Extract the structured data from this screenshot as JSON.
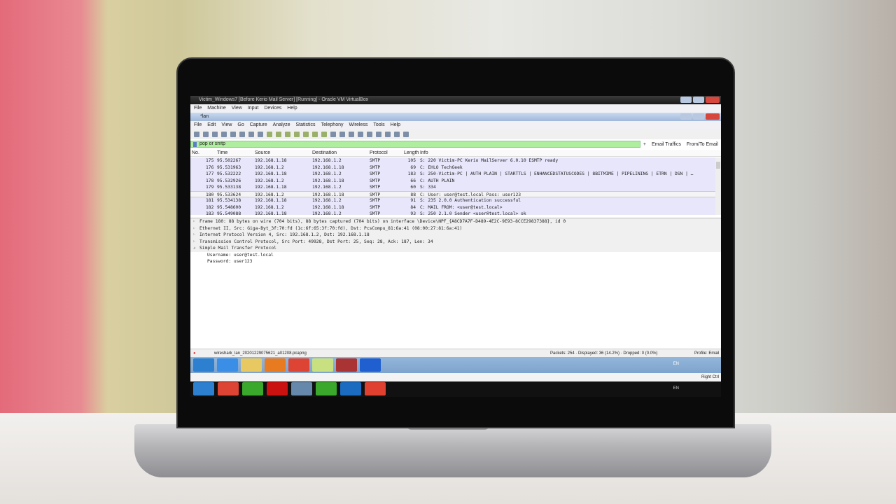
{
  "vbox": {
    "title": "Victim_Windows7 [Before Kerio Mail Server] [Running] - Oracle VM VirtualBox",
    "menu": [
      "File",
      "Machine",
      "View",
      "Input",
      "Devices",
      "Help"
    ],
    "status_right": "Right Ctrl"
  },
  "wireshark": {
    "title": "*lan",
    "menu": [
      "File",
      "Edit",
      "View",
      "Go",
      "Capture",
      "Analyze",
      "Statistics",
      "Telephony",
      "Wireless",
      "Tools",
      "Help"
    ],
    "filter": "pop or smtp",
    "filter_buttons": [
      "+",
      "Email Traffics",
      "From/To Email"
    ],
    "columns": [
      "No.",
      "Time",
      "Source",
      "Destination",
      "Protocol",
      "Length",
      "Info"
    ],
    "packets": [
      [
        "175",
        "95.502267",
        "192.168.1.18",
        "192.168.1.2",
        "SMTP",
        "105",
        "S: 220 Victim-PC Kerio MailServer 6.0.10 ESMTP ready"
      ],
      [
        "176",
        "95.531963",
        "192.168.1.2",
        "192.168.1.18",
        "SMTP",
        "69",
        "C: EHLO TechGeek"
      ],
      [
        "177",
        "95.532222",
        "192.168.1.18",
        "192.168.1.2",
        "SMTP",
        "183",
        "S: 250-Victim-PC | AUTH PLAIN | STARTTLS | ENHANCEDSTATUSCODES | 8BITMIME | PIPELINING | ETRN | DSN | …"
      ],
      [
        "178",
        "95.532926",
        "192.168.1.2",
        "192.168.1.18",
        "SMTP",
        "66",
        "C: AUTH PLAIN"
      ],
      [
        "179",
        "95.533138",
        "192.168.1.18",
        "192.168.1.2",
        "SMTP",
        "60",
        "S: 334"
      ],
      [
        "180",
        "95.533624",
        "192.168.1.2",
        "192.168.1.18",
        "SMTP",
        "88",
        "C: User: user@test.local  Pass: user123"
      ],
      [
        "181",
        "95.534138",
        "192.168.1.18",
        "192.168.1.2",
        "SMTP",
        "91",
        "S: 235 2.0.0 Authentication successful"
      ],
      [
        "182",
        "95.548600",
        "192.168.1.2",
        "192.168.1.18",
        "SMTP",
        "84",
        "C: MAIL FROM: <user@test.local>"
      ],
      [
        "183",
        "95.549088",
        "192.168.1.18",
        "192.168.1.2",
        "SMTP",
        "93",
        "S: 250 2.1.0 Sender <user@test.local> ok"
      ]
    ],
    "selected_packet": "180",
    "details": [
      "Frame 180: 88 bytes on wire (704 bits), 88 bytes captured (704 bits) on interface \\Device\\NPF_{A8CD7A7F-D489-4E2C-9E93-8CCE29837388}, id 0",
      "Ethernet II, Src: Giga-Byt_3f:70:fd (1c:6f:65:3f:70:fd), Dst: PcsCompu_81:6a:41 (08:00:27:81:6a:41)",
      "Internet Protocol Version 4, Src: 192.168.1.2, Dst: 192.168.1.18",
      "Transmission Control Protocol, Src Port: 49928, Dst Port: 25, Seq: 28, Ack: 187, Len: 34",
      "Simple Mail Transfer Protocol"
    ],
    "smtp_fields": [
      "Username: user@test.local",
      "Password: user123"
    ],
    "status_file": "wireshark_lan_20201229075621_a01208.pcapng",
    "status_counts": "Packets: 254 · Displayed: 36 (14.2%) · Dropped: 0 (0.0%)",
    "status_profile": "Profile: Email"
  },
  "guest_taskbar": {
    "apps": [
      "start",
      "internet-explorer",
      "explorer",
      "media-player",
      "chrome",
      "sticky-notes",
      "app",
      "wireshark"
    ],
    "lang": "EN"
  },
  "host_taskbar": {
    "apps": [
      "start",
      "chrome",
      "camtasia",
      "opera",
      "virtualbox",
      "camtasia-2",
      "outlook",
      "camtasia-red"
    ],
    "lang": "EN"
  }
}
